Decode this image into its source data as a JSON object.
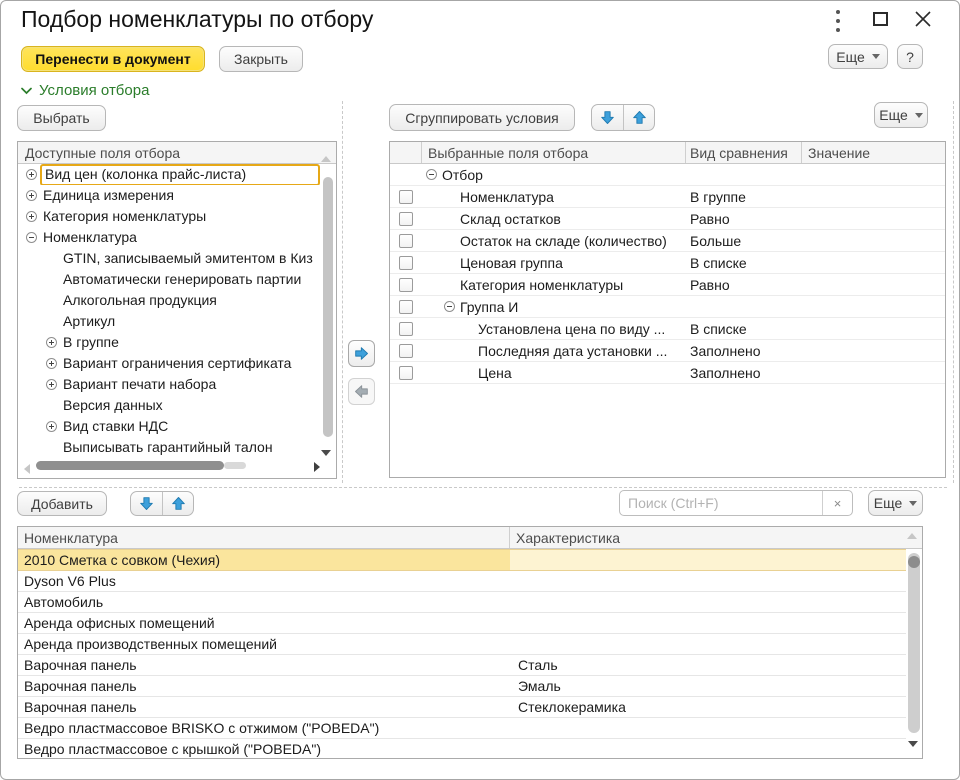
{
  "window": {
    "title": "Подбор номенклатуры по отбору"
  },
  "command_bar": {
    "transfer_button": "Перенести в документ",
    "close_button": "Закрыть",
    "more_button": "Еще",
    "help_button": "?"
  },
  "filter_section": {
    "toggle_label": "Условия отбора",
    "select_button": "Выбрать",
    "available_fields": {
      "header": "Доступные поля отбора",
      "items": [
        {
          "label": "Вид цен  (колонка прайс-листа)",
          "expander": "plus",
          "level": 1,
          "highlighted": true
        },
        {
          "label": "Единица измерения",
          "expander": "plus",
          "level": 1
        },
        {
          "label": "Категория номенклатуры",
          "expander": "plus",
          "level": 1
        },
        {
          "label": "Номенклатура",
          "expander": "minus",
          "level": 1
        },
        {
          "label": "GTIN, записываемый эмитентом в Киз",
          "expander": "none",
          "level": 2
        },
        {
          "label": "Автоматически генерировать партии",
          "expander": "none",
          "level": 2
        },
        {
          "label": "Алкогольная продукция",
          "expander": "none",
          "level": 2
        },
        {
          "label": "Артикул",
          "expander": "none",
          "level": 2
        },
        {
          "label": "В группе",
          "expander": "plus",
          "level": 2
        },
        {
          "label": "Вариант ограничения сертификата",
          "expander": "plus",
          "level": 2
        },
        {
          "label": "Вариант печати набора",
          "expander": "plus",
          "level": 2
        },
        {
          "label": "Версия данных",
          "expander": "none",
          "level": 2
        },
        {
          "label": "Вид ставки НДС",
          "expander": "plus",
          "level": 2
        },
        {
          "label": "Выписывать гарантийный талон",
          "expander": "none",
          "level": 2
        }
      ]
    },
    "group_button": "Сгруппировать условия",
    "more_button": "Еще",
    "selected_fields": {
      "columns": [
        "Выбранные поля отбора",
        "Вид сравнения",
        "Значение"
      ],
      "rows": [
        {
          "label": "Отбор",
          "expander": "minus",
          "level": 1,
          "checkbox": false,
          "comparison": "",
          "value": ""
        },
        {
          "label": "Номенклатура",
          "expander": "none",
          "level": 2,
          "checkbox": true,
          "comparison": "В группе",
          "value": ""
        },
        {
          "label": "Склад остатков",
          "expander": "none",
          "level": 2,
          "checkbox": true,
          "comparison": "Равно",
          "value": ""
        },
        {
          "label": "Остаток на складе (количество)",
          "expander": "none",
          "level": 2,
          "checkbox": true,
          "comparison": "Больше",
          "value": ""
        },
        {
          "label": "Ценовая группа",
          "expander": "none",
          "level": 2,
          "checkbox": true,
          "comparison": "В списке",
          "value": ""
        },
        {
          "label": "Категория номенклатуры",
          "expander": "none",
          "level": 2,
          "checkbox": true,
          "comparison": "Равно",
          "value": ""
        },
        {
          "label": "Группа И",
          "expander": "minus",
          "level": 2,
          "checkbox": true,
          "comparison": "",
          "value": ""
        },
        {
          "label": "Установлена цена по виду ...",
          "expander": "none",
          "level": 3,
          "checkbox": true,
          "comparison": "В списке",
          "value": ""
        },
        {
          "label": "Последняя дата установки ...",
          "expander": "none",
          "level": 3,
          "checkbox": true,
          "comparison": "Заполнено",
          "value": ""
        },
        {
          "label": "Цена",
          "expander": "none",
          "level": 3,
          "checkbox": true,
          "comparison": "Заполнено",
          "value": ""
        }
      ]
    }
  },
  "results_section": {
    "add_button": "Добавить",
    "search_placeholder": "Поиск (Ctrl+F)",
    "clear_search_icon": "×",
    "more_button": "Еще",
    "table": {
      "columns": [
        "Номенклатура",
        "Характеристика"
      ],
      "rows": [
        {
          "nomenclature": "2010 Сметка с совком (Чехия)",
          "characteristic": "",
          "selected": true
        },
        {
          "nomenclature": "Dyson V6 Plus",
          "characteristic": "",
          "selected": false
        },
        {
          "nomenclature": "Автомобиль",
          "characteristic": "",
          "selected": false
        },
        {
          "nomenclature": "Аренда офисных помещений",
          "characteristic": "",
          "selected": false
        },
        {
          "nomenclature": "Аренда производственных помещений",
          "characteristic": "",
          "selected": false
        },
        {
          "nomenclature": "Варочная панель",
          "characteristic": "Сталь",
          "selected": false
        },
        {
          "nomenclature": "Варочная панель",
          "characteristic": "Эмаль",
          "selected": false
        },
        {
          "nomenclature": "Варочная панель",
          "characteristic": "Стеклокерамика",
          "selected": false
        },
        {
          "nomenclature": "Ведро пластмассовое BRISKO с отжимом (\"POBEDA\")",
          "characteristic": "",
          "selected": false
        },
        {
          "nomenclature": "Ведро пластмассовое с крышкой (\"POBEDA\")",
          "characteristic": "",
          "selected": false
        }
      ]
    }
  },
  "colors": {
    "accent_yellow": "#ffdd2d",
    "yellow_border": "#d9b41e",
    "green_link": "#2b7d2b",
    "arrow_blue": "#3da0db",
    "selection_row_dark": "#fae59d",
    "selection_row_light": "#fdf3d2",
    "highlight_gold": "#e6a817"
  }
}
